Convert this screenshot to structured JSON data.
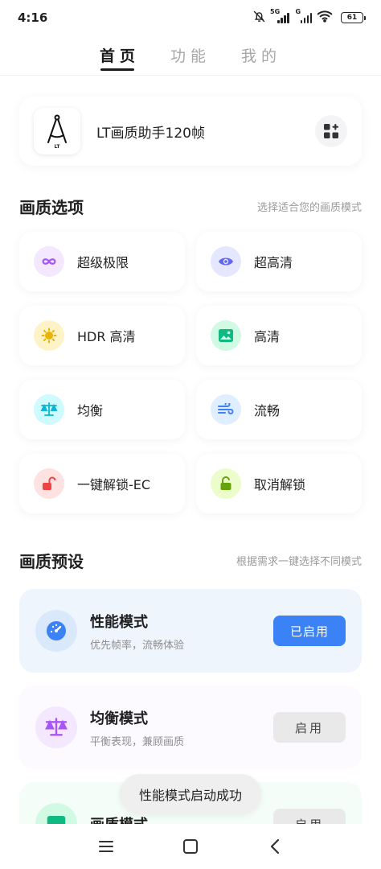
{
  "status_bar": {
    "time": "4:16",
    "network_1": "5G",
    "network_2": "G",
    "battery": "61",
    "icons": [
      "mute-bell-icon",
      "signal-icon",
      "signal-icon",
      "wifi-icon",
      "battery-icon"
    ]
  },
  "tabs": [
    {
      "label": "首页",
      "active": true
    },
    {
      "label": "功能",
      "active": false
    },
    {
      "label": "我的",
      "active": false
    }
  ],
  "app": {
    "name": "LT画质助手120帧",
    "logo_text": "LT",
    "logo_icon": "compass-icon",
    "action_icon": "apps-grid-add-icon"
  },
  "quality_options": {
    "title": "画质选项",
    "subtitle": "选择适合您的画质模式",
    "items": [
      {
        "label": "超级极限",
        "icon": "infinity-icon",
        "color": "#a855f7",
        "bg": "#f3e8ff"
      },
      {
        "label": "超高清",
        "icon": "eye-icon",
        "color": "#6366f1",
        "bg": "#e5e7ff"
      },
      {
        "label": "HDR 高清",
        "icon": "sun-icon",
        "color": "#eab308",
        "bg": "#fef3c7"
      },
      {
        "label": "高清",
        "icon": "image-icon",
        "color": "#10b981",
        "bg": "#d1fae5"
      },
      {
        "label": "均衡",
        "icon": "scale-icon",
        "color": "#06b6d4",
        "bg": "#cffafe"
      },
      {
        "label": "流畅",
        "icon": "wind-icon",
        "color": "#3b82f6",
        "bg": "#e0efff"
      },
      {
        "label": "一键解锁-EC",
        "icon": "unlock-icon",
        "color": "#ef4444",
        "bg": "#fee2e2"
      },
      {
        "label": "取消解锁",
        "icon": "lock-open-icon",
        "color": "#65a30d",
        "bg": "#ecfccb"
      }
    ]
  },
  "presets": {
    "title": "画质预设",
    "subtitle": "根据需求一键选择不同模式",
    "items": [
      {
        "title": "性能模式",
        "desc": "优先帧率，流畅体验",
        "button": "已启用",
        "active": true,
        "icon": "speedometer-icon"
      },
      {
        "title": "均衡模式",
        "desc": "平衡表现，兼顾画质",
        "button": "启用",
        "active": false,
        "icon": "scale-icon"
      },
      {
        "title": "画质模式",
        "desc": "",
        "button": "启用",
        "active": false,
        "icon": "image-icon"
      }
    ]
  },
  "toast": "性能模式启动成功",
  "colors": {
    "primary": "#3b82f6",
    "active_preset_bg": "#eef5fd",
    "balanced_preset_bg": "#fcf9ff",
    "quality_preset_bg": "#f4fdf7"
  }
}
